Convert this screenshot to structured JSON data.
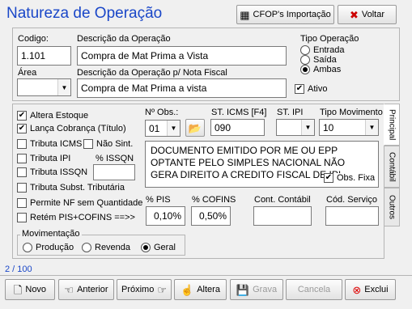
{
  "window": {
    "title": "Natureza de Operação"
  },
  "toolbar": {
    "cfop_label": "CFOP's Importação",
    "back_label": "Voltar"
  },
  "header": {
    "codigo_label": "Codigo:",
    "codigo_value": "1.101",
    "descricao_label": "Descrição da Operação",
    "descricao_value": "Compra de Mat Prima a Vista",
    "area_label": "Área",
    "area_value": "",
    "descricao_nf_label": "Descrição da Operação  p/ Nota Fiscal",
    "descricao_nf_value": "Compra de Mat Prima a vista",
    "tipo_operacao_label": "Tipo Operação",
    "tipo_options": [
      "Entrada",
      "Saída",
      "Ambas"
    ],
    "tipo_selected": "Ambas",
    "ativo_label": "Ativo",
    "ativo_checked": true
  },
  "principal": {
    "checks": {
      "altera_estoque": "Altera Estoque",
      "lanca_cobranca": "Lança Cobrança (Título)",
      "tributa_icms": "Tributa ICMS",
      "nao_sint": "Não Sint.",
      "tributa_ipi": "Tributa IPI",
      "issqn_pct_label": "% ISSQN",
      "tributa_issqn": "Tributa ISSQN",
      "tributa_subst": "Tributa Subst. Tributária",
      "permite_nf": "Permite NF sem Quantidade",
      "retem": "Retém  PIS+COFINS ==>>"
    },
    "obs_label": "Nº Obs.:",
    "obs_value": "01",
    "st_icms_label": "ST. ICMS [F4]",
    "st_icms_value": "090",
    "st_ipi_label": "ST. IPI",
    "st_ipi_value": "",
    "tipo_mov_label": "Tipo Movimento",
    "tipo_mov_value": "10",
    "obs_text": "DOCUMENTO EMITIDO POR ME OU EPP OPTANTE PELO SIMPLES NACIONAL NÃO GERA DIREITO A CREDITO FISCAL DE IPI",
    "obs_fixa_label": "Obs. Fixa",
    "pis_label": "% PIS",
    "pis_value": "0,10%",
    "cofins_label": "% COFINS",
    "cofins_value": "0,50%",
    "conta_label": "Cont. Contábil",
    "conta_value": "",
    "servico_label": "Cód. Serviço",
    "servico_value": "",
    "movimentacao_label": "Movimentação",
    "mov_options": [
      "Produção",
      "Revenda",
      "Geral"
    ],
    "mov_selected": "Geral"
  },
  "tabs": [
    "Principal",
    "Contábil",
    "Outros"
  ],
  "status": {
    "record": "2 / 100"
  },
  "buttons": {
    "novo": "Novo",
    "anterior": "Anterior",
    "proximo": "Próximo",
    "altera": "Altera",
    "grava": "Grava",
    "cancela": "Cancela",
    "exclui": "Exclui"
  }
}
